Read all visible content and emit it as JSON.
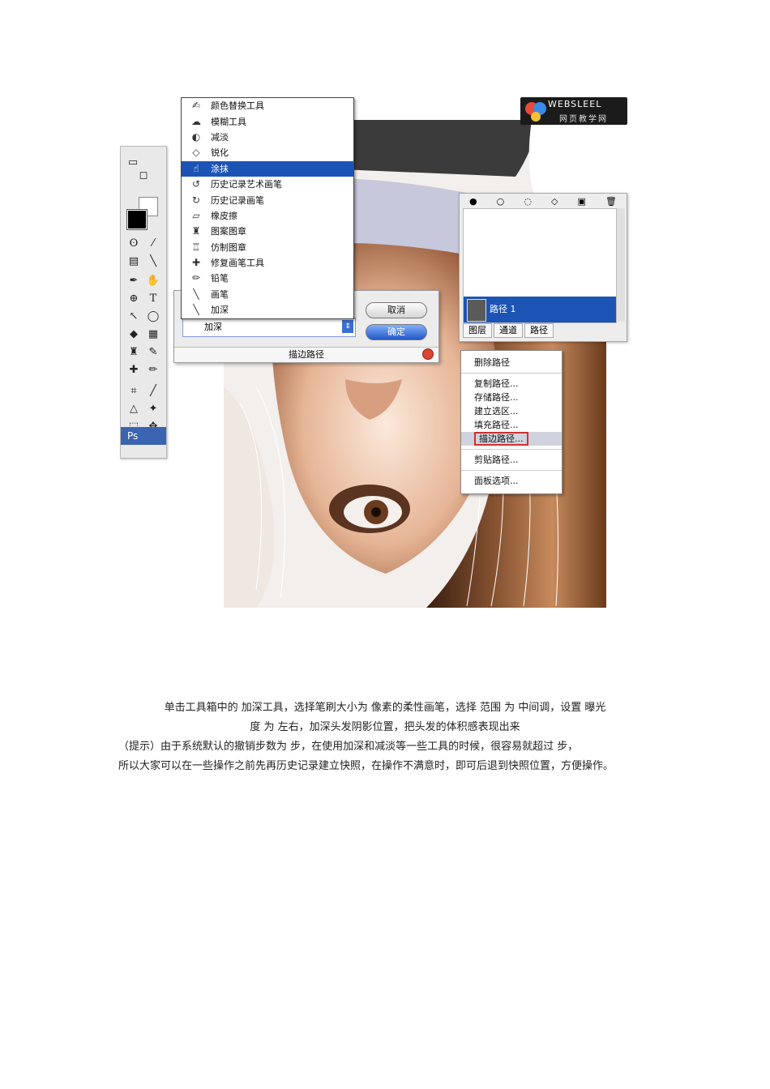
{
  "tool_menu": {
    "items": [
      {
        "label": "颜色替换工具",
        "icon": "color-replace-icon"
      },
      {
        "label": "模糊工具",
        "icon": "blur-icon"
      },
      {
        "label": "减淡",
        "icon": "dodge-icon"
      },
      {
        "label": "锐化",
        "icon": "sharpen-icon"
      },
      {
        "label": "涂抹",
        "icon": "smudge-icon",
        "selected": true
      },
      {
        "label": "历史记录艺术画笔",
        "icon": "art-history-brush-icon"
      },
      {
        "label": "历史记录画笔",
        "icon": "history-brush-icon"
      },
      {
        "label": "橡皮擦",
        "icon": "eraser-icon"
      },
      {
        "label": "图案图章",
        "icon": "pattern-stamp-icon"
      },
      {
        "label": "仿制图章",
        "icon": "clone-stamp-icon"
      },
      {
        "label": "修复画笔工具",
        "icon": "healing-brush-icon"
      },
      {
        "label": "铅笔",
        "icon": "pencil-icon"
      },
      {
        "label": "画笔",
        "icon": "brush-icon"
      },
      {
        "label": "加深",
        "icon": "burn-icon"
      }
    ]
  },
  "dialog": {
    "select_value": "加深",
    "cancel_label": "取消",
    "ok_label": "确定",
    "title": "描边路径"
  },
  "logo": {
    "top": "WEBSLEEL",
    "bottom": "网页教学网"
  },
  "toolbox": {
    "footer": "Ps"
  },
  "paths_panel": {
    "row_name": "路径 1",
    "tabs": [
      "图层",
      "通道",
      "路径"
    ]
  },
  "context_menu": {
    "items": [
      "删除路径",
      "复制路径...",
      "存储路径...",
      "建立选区...",
      "填充路径...",
      "描边路径...",
      "剪贴路径...",
      "面板选项..."
    ],
    "highlighted_index": 5
  },
  "caption": {
    "line1": "单击工具箱中的 加深工具，选择笔刷大小为 像素的柔性画笔，选择 范围 为 中间调，设置 曝光",
    "line2": "度 为 左右，加深头发阴影位置，把头发的体积感表现出来",
    "line3": "（提示）由于系统默认的撤销步数为 步，在使用加深和减淡等一些工具的时候，很容易就超过 步，",
    "line4": "所以大家可以在一些操作之前先再历史记录建立快照，在操作不满意时，即可后退到快照位置，方便操作。"
  },
  "colors": {
    "selection_blue": "#1c54b5",
    "highlight_red": "#d03030",
    "hair_brown": "#6b3a1f",
    "skin": "#e9c1a6"
  }
}
